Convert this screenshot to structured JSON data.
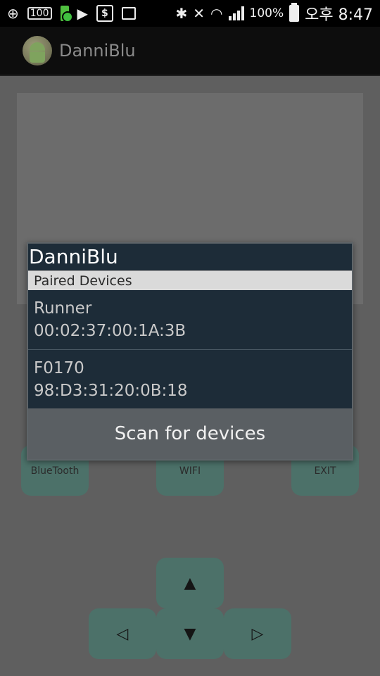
{
  "status_bar": {
    "icons": [
      "plus-icon",
      "100-battery-icon",
      "charging-battery-icon",
      "play-icon",
      "dollar-app-icon",
      "image-icon"
    ],
    "right_icons": [
      "bluetooth-icon",
      "vibrate-mute-icon",
      "wifi-icon",
      "signal-icon"
    ],
    "battery_text": "100%",
    "time": "오후 8:47"
  },
  "action_bar": {
    "title": "DanniBlu"
  },
  "buttons": {
    "bluetooth": "BlueTooth",
    "wifi": "WIFI",
    "exit": "EXIT"
  },
  "dpad": {
    "up": "▲",
    "down": "▼",
    "left": "◁",
    "right": "▷"
  },
  "dialog": {
    "title": "DanniBlu",
    "subheader": "Paired Devices",
    "devices": [
      {
        "name": "Runner",
        "address": "00:02:37:00:1A:3B"
      },
      {
        "name": "F0170",
        "address": "98:D3:31:20:0B:18"
      }
    ],
    "scan_label": "Scan for devices"
  }
}
